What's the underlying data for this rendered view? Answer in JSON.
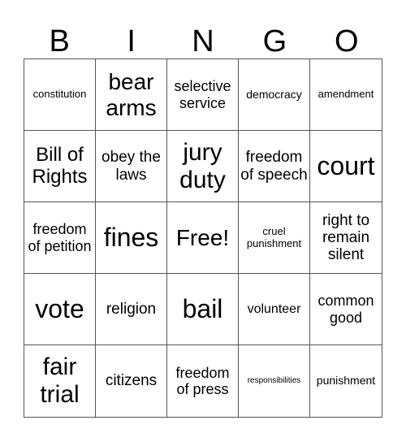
{
  "header": [
    "B",
    "I",
    "N",
    "G",
    "O"
  ],
  "cells": [
    {
      "text": "constitution",
      "size": "s13"
    },
    {
      "text": "bear arms",
      "size": "s28"
    },
    {
      "text": "selective service",
      "size": "s18"
    },
    {
      "text": "democracy",
      "size": "s14"
    },
    {
      "text": "amendment",
      "size": "s13"
    },
    {
      "text": "Bill of Rights",
      "size": "s24"
    },
    {
      "text": "obey the laws",
      "size": "s19"
    },
    {
      "text": "jury duty",
      "size": "s30"
    },
    {
      "text": "freedom of speech",
      "size": "s19"
    },
    {
      "text": "court",
      "size": "s32"
    },
    {
      "text": "freedom of petition",
      "size": "s18"
    },
    {
      "text": "fines",
      "size": "s32"
    },
    {
      "text": "Free!",
      "size": "s28"
    },
    {
      "text": "cruel punishment",
      "size": "s13"
    },
    {
      "text": "right to remain silent",
      "size": "s19"
    },
    {
      "text": "vote",
      "size": "s32"
    },
    {
      "text": "religion",
      "size": "s19"
    },
    {
      "text": "bail",
      "size": "s32"
    },
    {
      "text": "volunteer",
      "size": "s16"
    },
    {
      "text": "common good",
      "size": "s18"
    },
    {
      "text": "fair trial",
      "size": "s30"
    },
    {
      "text": "citizens",
      "size": "s19"
    },
    {
      "text": "freedom of press",
      "size": "s18"
    },
    {
      "text": "responsibilities",
      "size": "s10"
    },
    {
      "text": "punishment",
      "size": "s14"
    }
  ]
}
